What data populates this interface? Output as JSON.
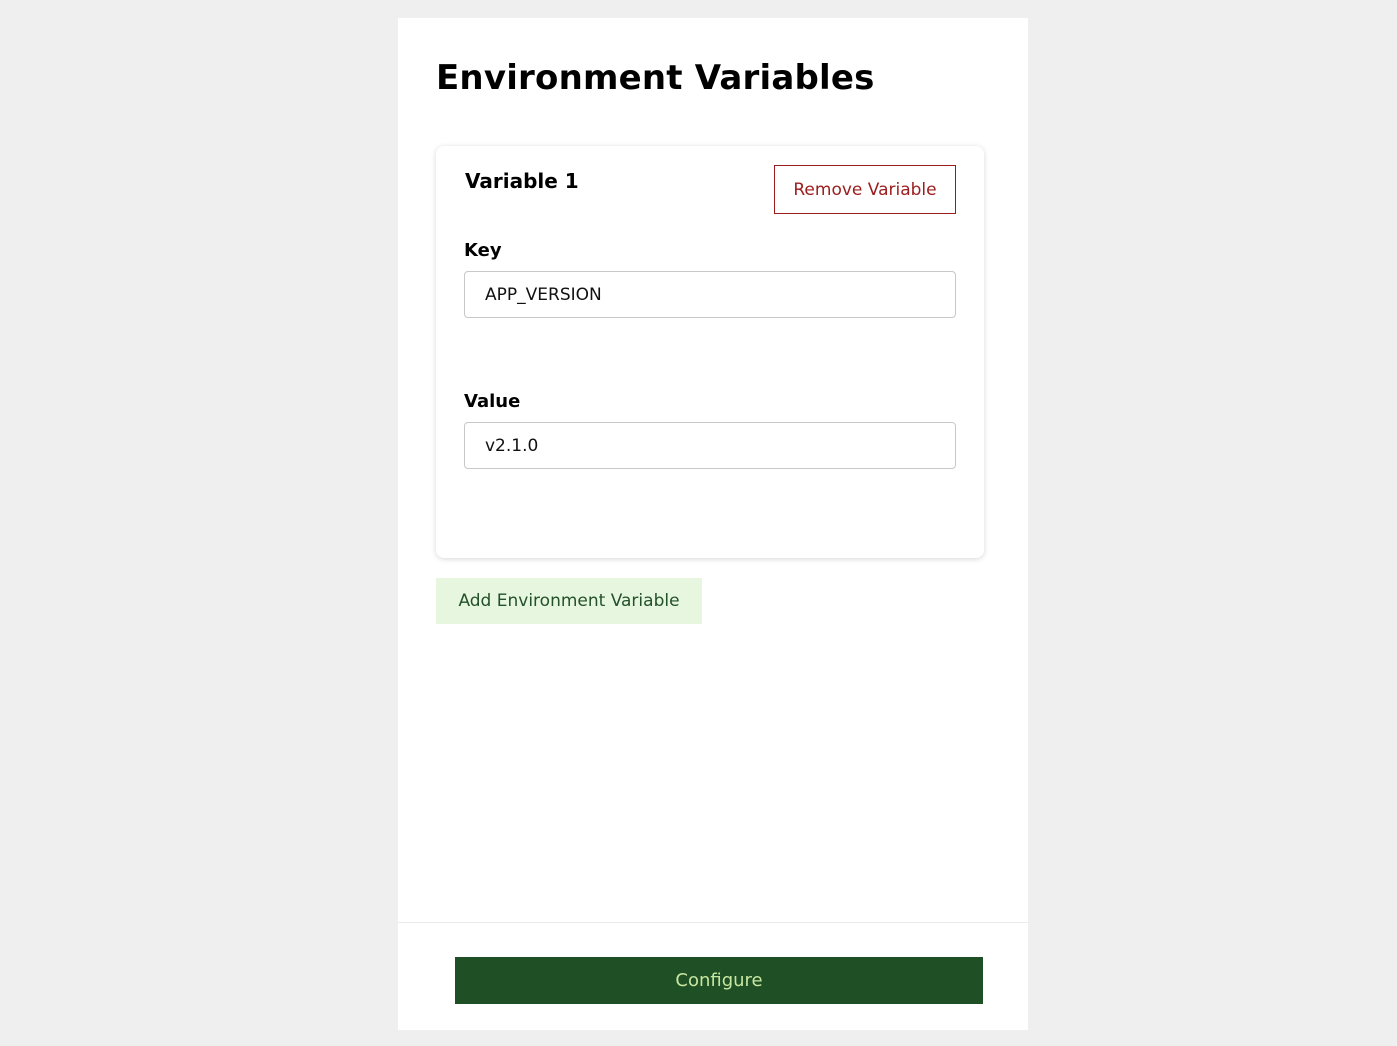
{
  "page": {
    "title": "Environment Variables"
  },
  "variables": [
    {
      "title": "Variable 1",
      "remove_label": "Remove Variable",
      "key_label": "Key",
      "key_value": "APP_VERSION",
      "value_label": "Value",
      "value_value": "v2.1.0"
    }
  ],
  "actions": {
    "add_label": "Add Environment Variable",
    "configure_label": "Configure"
  },
  "colors": {
    "background": "#efefef",
    "remove_accent": "#9b1c1c",
    "add_bg": "#e6f6df",
    "add_text": "#24502a",
    "primary": "#1f4f24",
    "primary_text": "#c8e6a0"
  }
}
